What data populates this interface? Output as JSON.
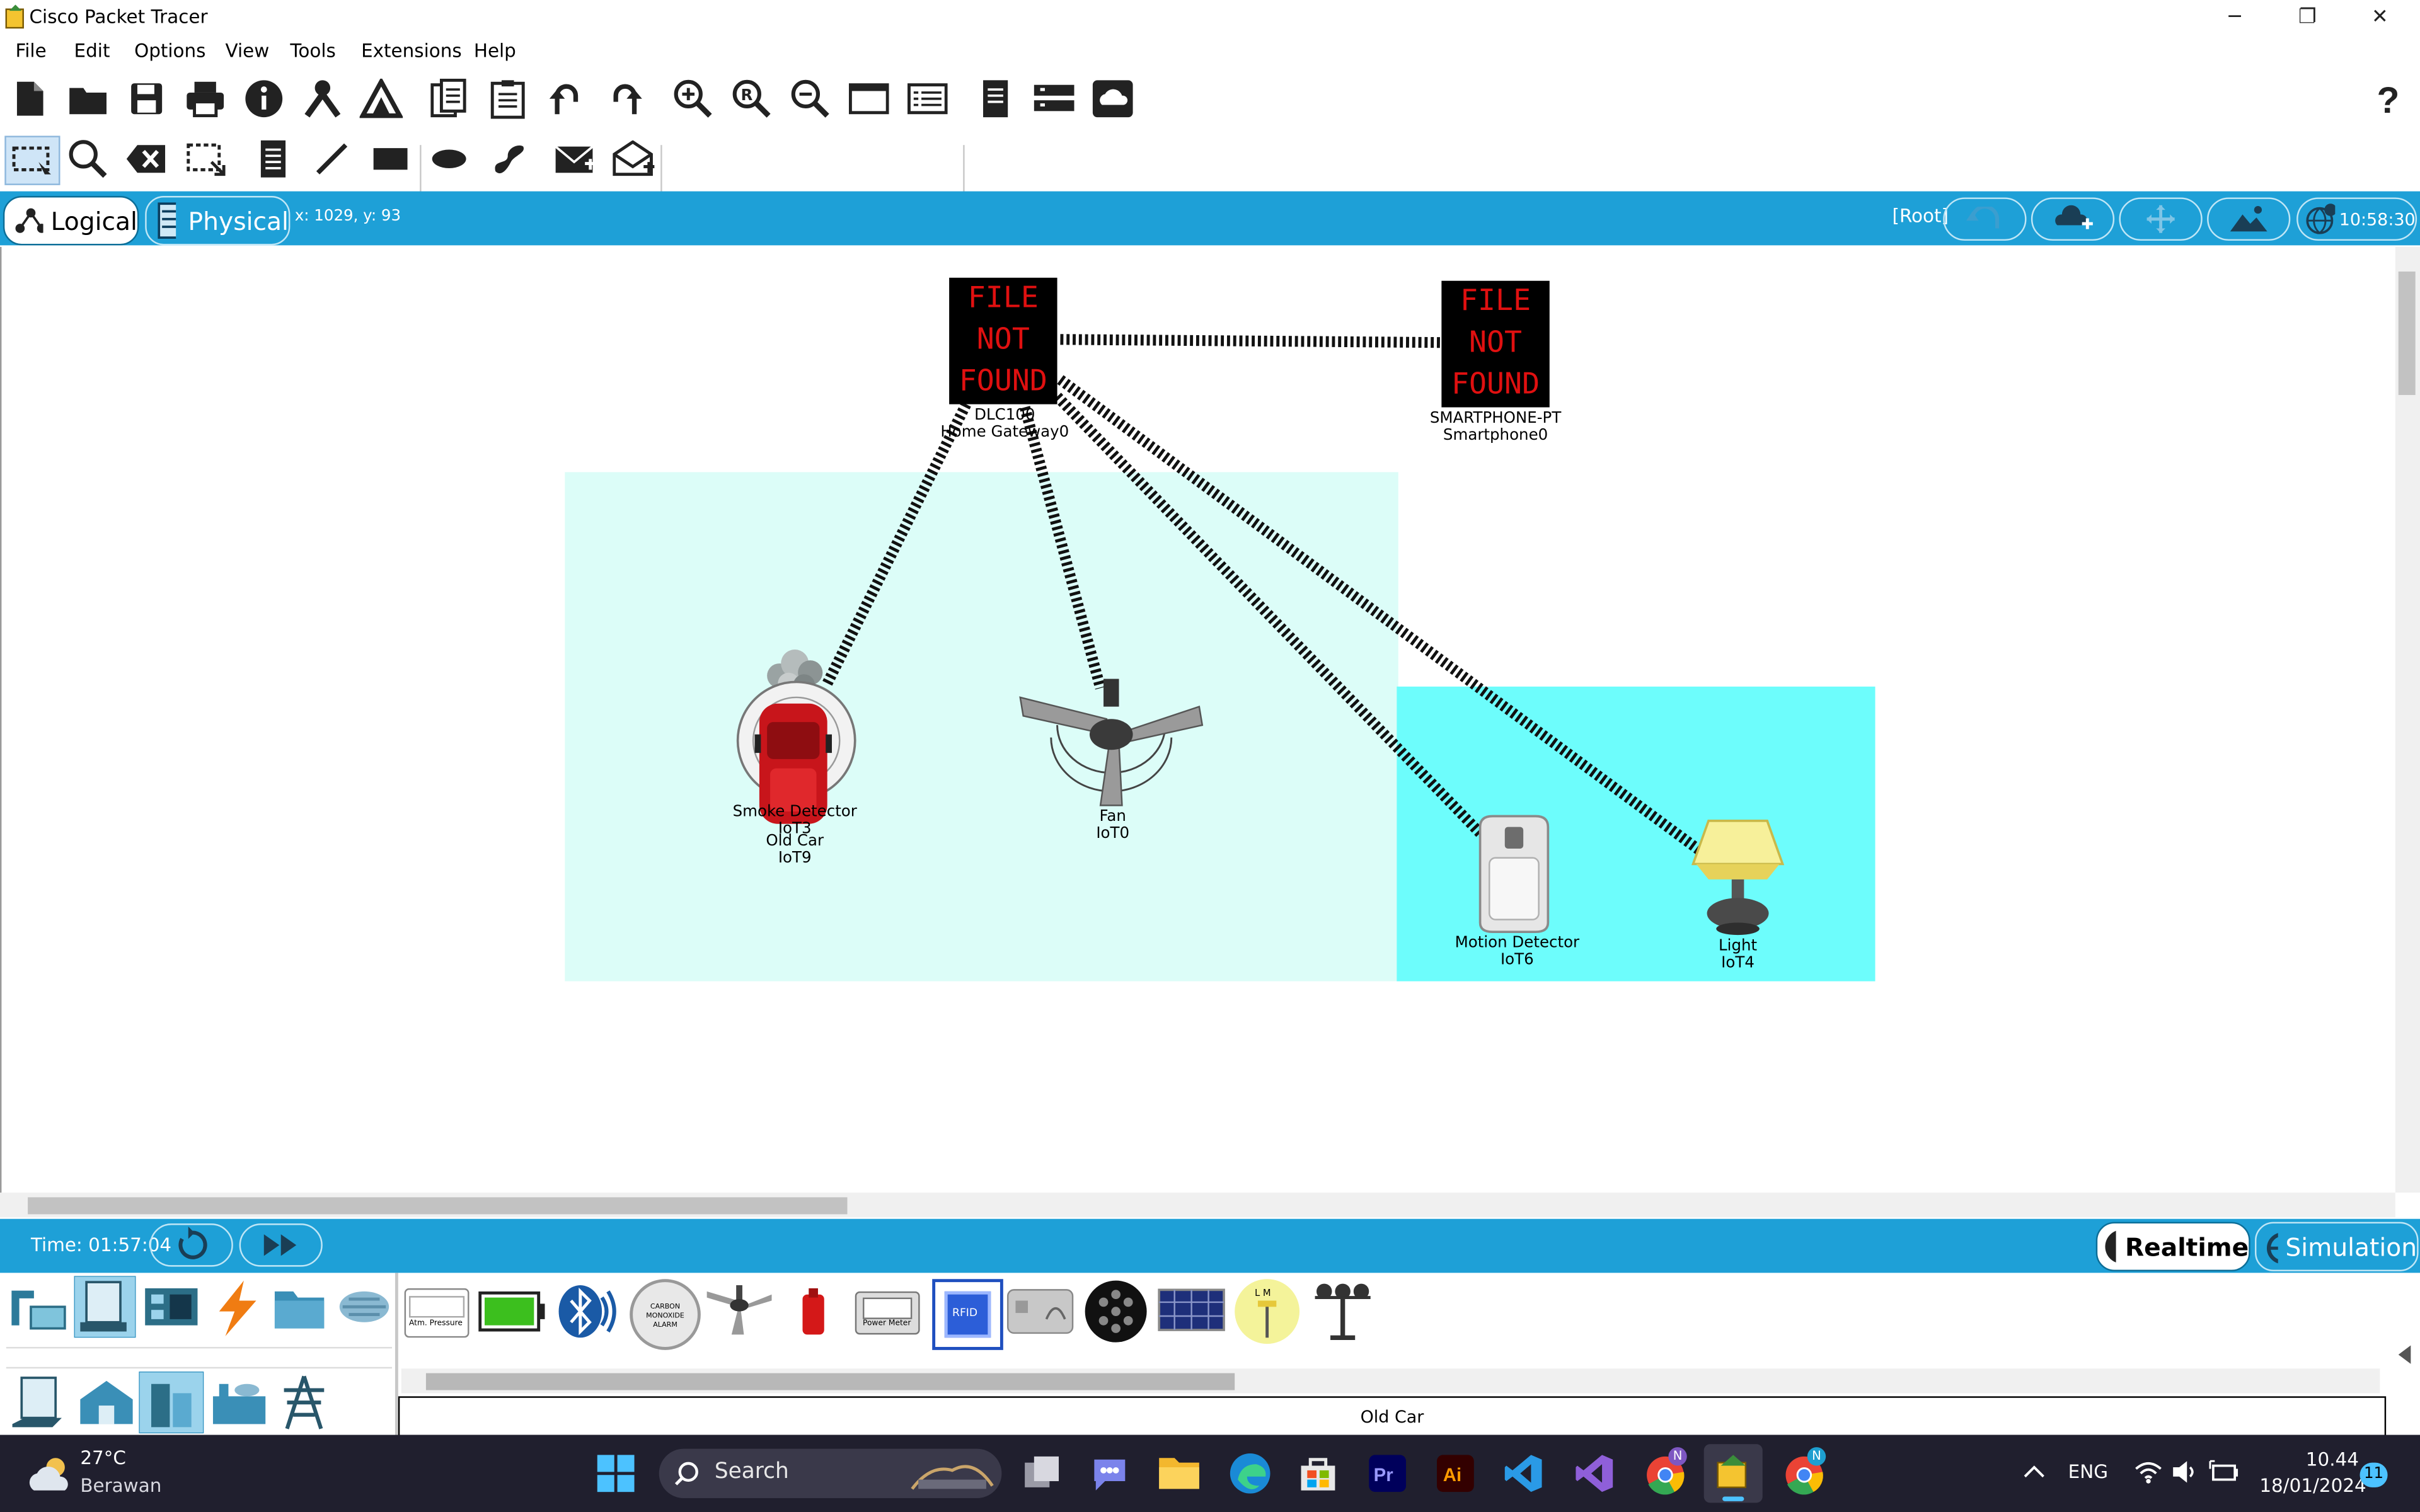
{
  "window": {
    "title": "Cisco Packet Tracer",
    "minimize": "─",
    "restore": "❐",
    "close": "✕"
  },
  "menu": [
    "File",
    "Edit",
    "Options",
    "View",
    "Tools",
    "Extensions",
    "Help"
  ],
  "mode_bar": {
    "logical_label": "Logical",
    "physical_label": "Physical",
    "coords": "x: 1029, y: 93",
    "root_label": "[Root]",
    "clock": "10:58:30"
  },
  "devices": {
    "gateway": {
      "image_text": [
        "FILE",
        "NOT",
        "FOUND"
      ],
      "label1": "DLC100",
      "label2": "Home Gateway0"
    },
    "smartphone": {
      "image_text": [
        "FILE",
        "NOT",
        "FOUND"
      ],
      "label1": "SMARTPHONE-PT",
      "label2": "Smartphone0"
    },
    "smoke": {
      "label1": "Smoke Detector",
      "label2": "IoT3"
    },
    "old_car": {
      "label1": "Old Car",
      "label2": "IoT9"
    },
    "fan": {
      "label1": "Fan",
      "label2": "IoT0"
    },
    "motion": {
      "label1": "Motion Detector",
      "label2": "IoT6"
    },
    "light": {
      "label1": "Light",
      "label2": "IoT4"
    }
  },
  "sim_bar": {
    "time": "Time: 01:57:04",
    "realtime": "Realtime",
    "simulation": "Simulation"
  },
  "palette": {
    "selected_device": "Old Car",
    "mini_labels": {
      "pressure": "Atm. Pressure",
      "co_alarm": "CARBON MONOXIDE ALARM",
      "power": "Power Meter",
      "rfid": "RFID",
      "lamp": "L M"
    }
  },
  "taskbar": {
    "temperature": "27°C",
    "weather": "Berawan",
    "search": "Search",
    "lang": "ENG",
    "time": "10.44",
    "date": "18/01/2024",
    "notif_count": "11",
    "badge_n": "N"
  },
  "colors": {
    "accent_blue": "#1ea0d7",
    "room1": "#dcfdf8",
    "room2": "#6dfdfc"
  }
}
